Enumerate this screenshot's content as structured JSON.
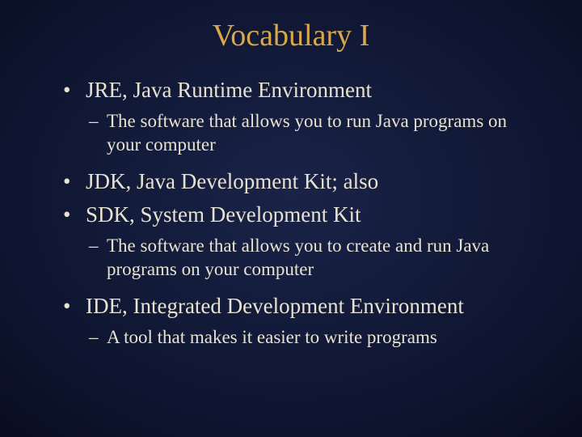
{
  "title": "Vocabulary I",
  "bullets": [
    {
      "text": "JRE, Java Runtime Environment",
      "subs": [
        "The software that allows you to run Java programs on your computer"
      ]
    },
    {
      "text": "JDK, Java Development Kit; also",
      "subs": []
    },
    {
      "text": "SDK, System Development Kit",
      "subs": [
        "The software that allows you to create and run Java programs on your computer"
      ]
    },
    {
      "text": "IDE, Integrated Development Environment",
      "subs": [
        "A tool that makes it easier to write programs"
      ]
    }
  ]
}
